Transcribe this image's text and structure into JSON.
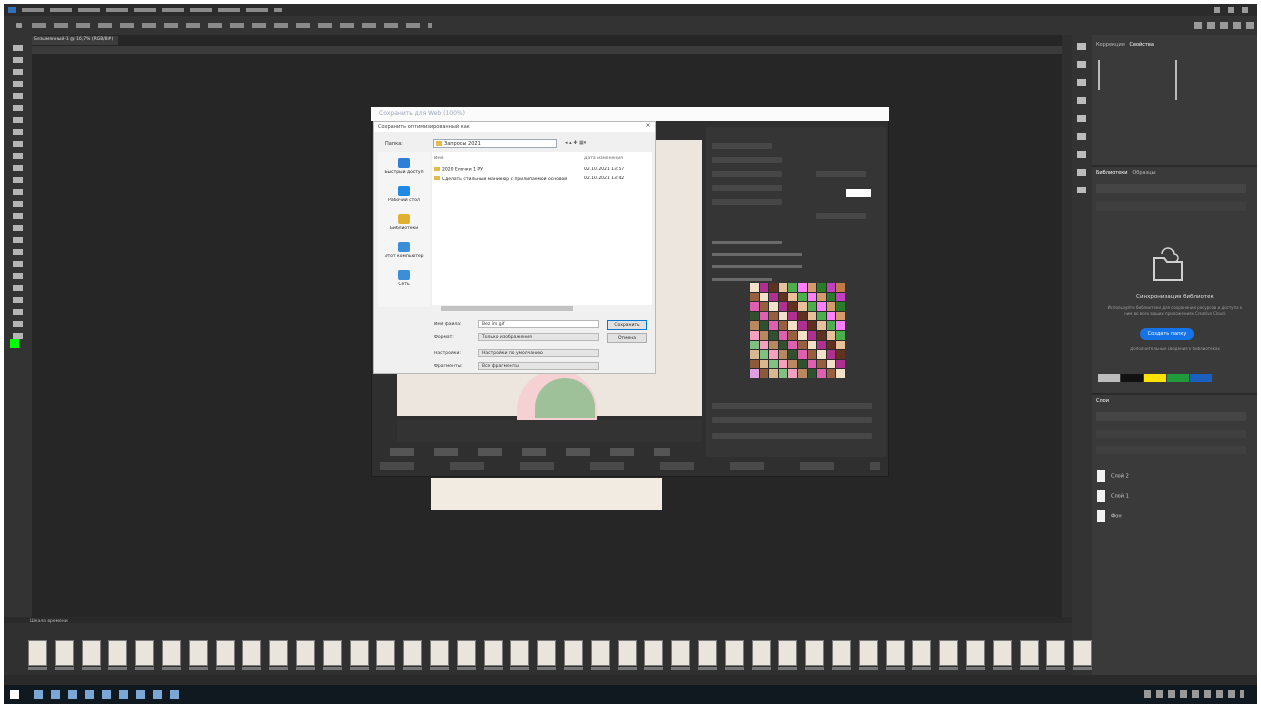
{
  "app": {
    "name": "Adobe Photoshop",
    "document_tab": "Безымянный-1 @ 16,7% (RGB/8#)"
  },
  "dialog_save_for_web": {
    "title": "Сохранить для Web (100%)"
  },
  "save_dialog": {
    "title": "Сохранить оптимизированный как",
    "folder_label": "Папка:",
    "folder_value": "Запросы 2021",
    "column_name": "Имя",
    "column_date": "Дата изменения",
    "files": [
      {
        "name": "2020 Ёлочки 1 РУ",
        "date": "02.10.2021 13:57"
      },
      {
        "name": "Сделать стильный маникюр с прилипаемой основой",
        "date": "02.10.2021 13:42"
      }
    ],
    "places": [
      {
        "label": "Быстрый доступ",
        "icon": "star-icon"
      },
      {
        "label": "Рабочий стол",
        "icon": "desktop-icon"
      },
      {
        "label": "Библиотеки",
        "icon": "library-icon"
      },
      {
        "label": "Этот компьютер",
        "icon": "computer-icon"
      },
      {
        "label": "Сеть",
        "icon": "network-icon"
      }
    ],
    "filename_label": "Имя файла:",
    "filename_value": "Bez im.gif",
    "format_label": "Формат:",
    "format_value": "Только изображения",
    "settings_label": "Настройки:",
    "settings_value": "Настройки по умолчанию",
    "slices_label": "Фрагменты:",
    "slices_value": "Все фрагменты",
    "save_button": "Сохранить",
    "cancel_button": "Отмена"
  },
  "right_panel": {
    "tabs_top": [
      "Коррекция",
      "Свойства"
    ],
    "tabs_mid": [
      "Библиотеки",
      "Образцы"
    ],
    "lib_title": "Синхронизация библиотек",
    "lib_desc": "Используйте библиотеки для сохранения ресурсов и доступа к ним во всех ваших приложениях Creative Cloud.",
    "lib_button": "Создать папку",
    "lib_link": "Дополнительные сведения о библиотеках",
    "layers_tab": "Слои",
    "layers": [
      "Слой 2",
      "Слой 1",
      "Фон"
    ]
  },
  "film_header": "Шкала времени",
  "colors": {
    "accent": "#1473e6",
    "canvas": "#262626",
    "panel": "#3a3a3a",
    "fg_swatch": "#00ff00",
    "bg_swatch": "#ff0000"
  }
}
